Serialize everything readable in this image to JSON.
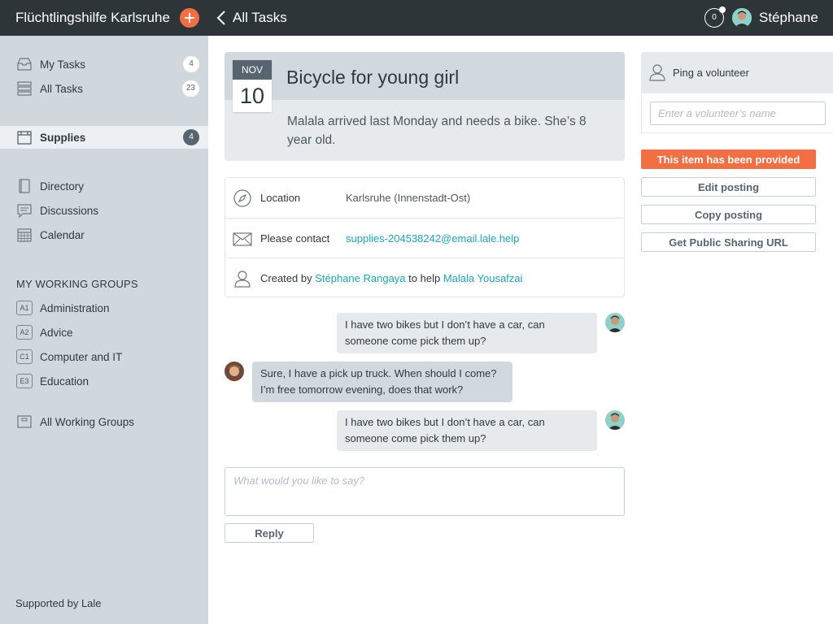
{
  "header": {
    "org_name": "Flüchtlingshilfe Karlsruhe",
    "back_label": "All Tasks",
    "notification_count": "0",
    "user_name": "Stéphane"
  },
  "sidebar": {
    "items": [
      {
        "label": "My Tasks",
        "count": "4",
        "icon": "inbox-icon"
      },
      {
        "label": "All Tasks",
        "count": "23",
        "icon": "stack-icon"
      },
      {
        "label": "Supplies",
        "count": "4",
        "icon": "supplies-icon",
        "active": true
      },
      {
        "label": "Directory",
        "icon": "book-icon"
      },
      {
        "label": "Discussions",
        "icon": "chat-icon"
      },
      {
        "label": "Calendar",
        "icon": "calendar-icon"
      }
    ],
    "groups_title": "MY WORKING GROUPS",
    "groups": [
      {
        "badge": "A1",
        "label": "Administration"
      },
      {
        "badge": "A2",
        "label": "Advice"
      },
      {
        "badge": "C1",
        "label": "Computer and IT"
      },
      {
        "badge": "E3",
        "label": "Education"
      }
    ],
    "all_groups_label": "All Working Groups",
    "footer": "Supported by Lale"
  },
  "task": {
    "month": "NOV",
    "day": "10",
    "title": "Bicycle for young girl",
    "description": "Malala arrived last Monday and needs a bike. She’s 8 year old."
  },
  "details": {
    "location_label": "Location",
    "location_value": "Karlsruhe (Innenstadt-Ost)",
    "contact_label": "Please contact",
    "contact_email": "supplies-204538242@email.lale.help",
    "created_prefix": "Created by",
    "creator": "Stéphane Rangaya",
    "help_text": "to help",
    "beneficiary": "Malala Yousafzai"
  },
  "messages": [
    {
      "text": "I have two bikes but I don’t have a car, can someone come pick them up?",
      "from": "self"
    },
    {
      "text": "Sure, I have a pick up truck. When should I come? I’m free tomorrow evening, does that work?",
      "from": "other"
    },
    {
      "text": "I have two bikes but I don’t have a car, can someone come pick them up?",
      "from": "self"
    }
  ],
  "reply": {
    "placeholder": "What would you like to say?",
    "button_label": "Reply"
  },
  "right_panel": {
    "ping_label": "Ping a volunteer",
    "ping_placeholder": "Enter a volunteer’s name",
    "provided_label": "This item has been provided",
    "edit_label": "Edit posting",
    "copy_label": "Copy posting",
    "share_label": "Get Public Sharing URL"
  },
  "colors": {
    "topbar": "#2e3539",
    "sidebar": "#d0d8dd",
    "accent": "#f26e43",
    "link": "#1aa6b7"
  }
}
